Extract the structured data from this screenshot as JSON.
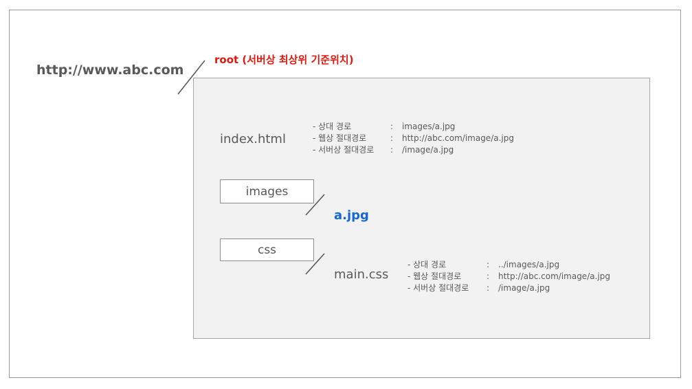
{
  "site_url": "http://www.abc.com",
  "root_label": "root (서버상 최상위 기준위치)",
  "index_file": {
    "name": "index.html",
    "paths": [
      {
        "label": "- 상대 경로",
        "sep": ":",
        "value": "images/a.jpg"
      },
      {
        "label": "- 웹상 절대경로",
        "sep": ":",
        "value": "http://abc.com/image/a.jpg"
      },
      {
        "label": "- 서버상 절대경로",
        "sep": ":",
        "value": "/image/a.jpg"
      }
    ]
  },
  "images_folder": {
    "name": "images",
    "file": "a.jpg"
  },
  "css_folder": {
    "name": "css",
    "file": "main.css",
    "paths": [
      {
        "label": "- 상대 경로",
        "sep": ":",
        "value": "../images/a.jpg"
      },
      {
        "label": "- 웹상 절대경로",
        "sep": ":",
        "value": "http://abc.com/image/a.jpg"
      },
      {
        "label": "- 서버상 절대경로",
        "sep": ":",
        "value": "/image/a.jpg"
      }
    ]
  },
  "colors": {
    "root_label": "#e0190f",
    "file_highlight": "#1566d6",
    "text": "#595959",
    "box_fill": "#f2f2f2"
  }
}
